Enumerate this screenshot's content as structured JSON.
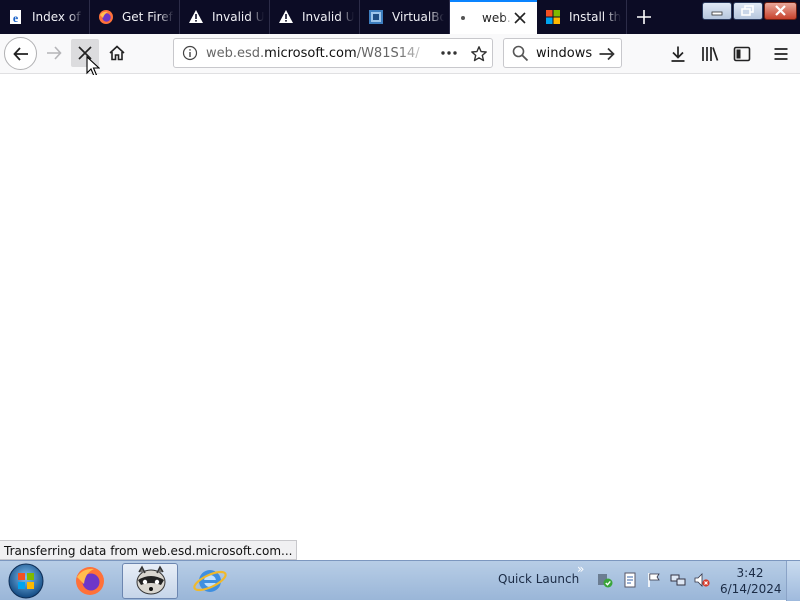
{
  "tabs": [
    {
      "title": "Index of",
      "icon": "ie-page-icon",
      "active": false
    },
    {
      "title": "Get Firefox",
      "icon": "firefox-icon",
      "active": false
    },
    {
      "title": "Invalid U",
      "icon": "warning-icon",
      "active": false
    },
    {
      "title": "Invalid U",
      "icon": "warning-icon",
      "active": false
    },
    {
      "title": "VirtualBox",
      "icon": "virtualbox-icon",
      "active": false
    },
    {
      "title": "web.e",
      "icon": "loading-dot-icon",
      "active": true
    },
    {
      "title": "Install th",
      "icon": "windows-logo-icon",
      "active": false
    }
  ],
  "urlbar": {
    "prefix": "web.esd.",
    "domain": "microsoft.com",
    "path": "/W81S14/"
  },
  "searchbar": {
    "value": "windows"
  },
  "status_text": "Transferring data from web.esd.microsoft.com...",
  "taskbar": {
    "quick_launch_label": "Quick Launch",
    "quick_launch_chevron": "»",
    "time": "3:42",
    "date": "6/14/2024"
  }
}
